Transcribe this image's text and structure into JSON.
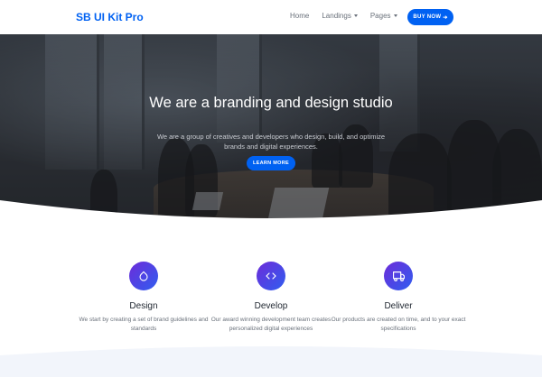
{
  "navbar": {
    "brand": "SB UI Kit Pro",
    "links": [
      {
        "label": "Home",
        "dropdown": false
      },
      {
        "label": "Landings",
        "dropdown": true
      },
      {
        "label": "Pages",
        "dropdown": true
      }
    ],
    "buy_button": "BUY NOW",
    "buy_arrow": "➔"
  },
  "hero": {
    "title": "We are a branding and design studio",
    "subtitle": "We are a group of creatives and developers who design, build, and optimize brands and digital experiences.",
    "button": "LEARN MORE"
  },
  "features": [
    {
      "icon": "droplet-icon",
      "title": "Design",
      "description": "We start by creating a set of brand guidelines and standards"
    },
    {
      "icon": "code-icon",
      "title": "Develop",
      "description": "Our award winning development team creates personalized digital experiences"
    },
    {
      "icon": "truck-icon",
      "title": "Deliver",
      "description": "Our products are created on time, and to your exact specifications"
    }
  ],
  "colors": {
    "primary": "#0061f2",
    "icon_gradient_start": "#6d2bd9",
    "icon_gradient_end": "#2f5ef0",
    "heading": "#212832",
    "body_text": "#69707a"
  }
}
